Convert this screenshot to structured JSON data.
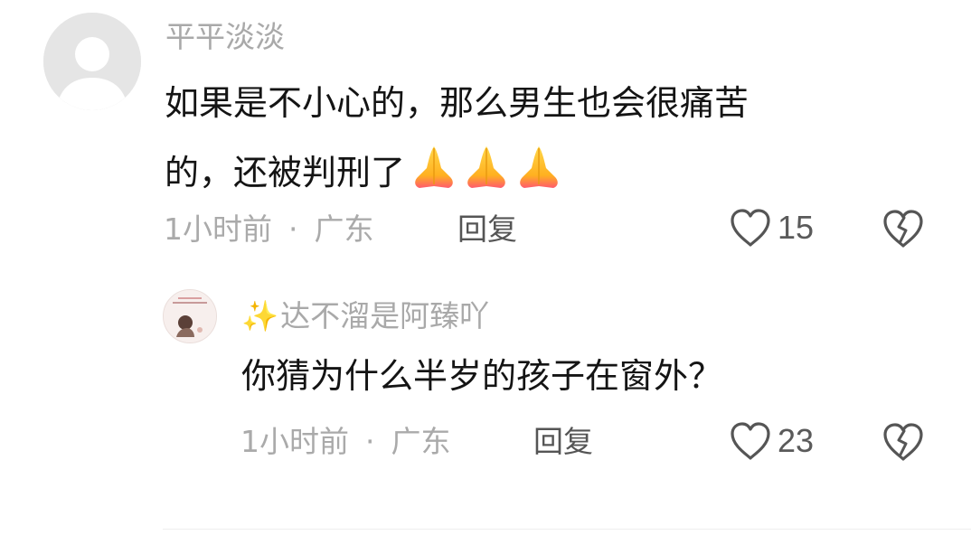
{
  "comment": {
    "username": "平平淡淡",
    "text_line1": "如果是不小心的，那么男生也会很痛苦",
    "text_line2": "的，还被判刑了",
    "emoji": "🙏🙏🙏",
    "time": "1小时前",
    "separator": "·",
    "location": "广东",
    "reply_label": "回复",
    "like_count": "15"
  },
  "reply": {
    "username_prefix": "✨",
    "username": "达不溜是阿臻吖",
    "text": "你猜为什么半岁的孩子在窗外？",
    "time": "1小时前",
    "separator": "·",
    "location": "广东",
    "reply_label": "回复",
    "like_count": "23"
  },
  "colors": {
    "username": "#a9a9a9",
    "meta": "#aaaaaa",
    "body_text": "#141414",
    "icon": "#555555"
  },
  "icons": [
    "user-avatar-icon",
    "heart-icon",
    "broken-heart-icon",
    "folded-hands-emoji",
    "sparkle-icon"
  ]
}
